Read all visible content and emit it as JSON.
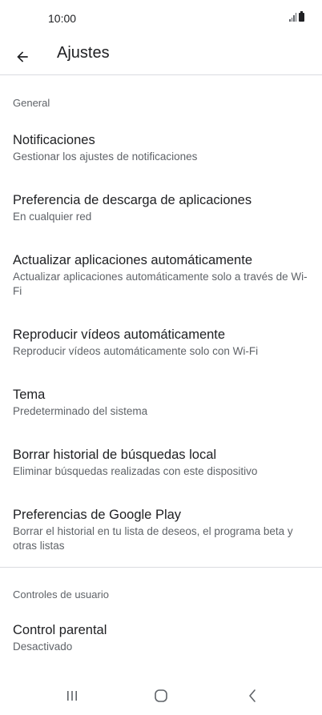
{
  "status_bar": {
    "time": "10:00"
  },
  "header": {
    "title": "Ajustes",
    "back_icon": "arrow-back-icon"
  },
  "sections": [
    {
      "label": "General",
      "items": [
        {
          "title": "Notificaciones",
          "subtitle": "Gestionar los ajustes de notificaciones"
        },
        {
          "title": "Preferencia de descarga de aplicaciones",
          "subtitle": "En cualquier red"
        },
        {
          "title": "Actualizar aplicaciones automáticamente",
          "subtitle": "Actualizar aplicaciones automáticamente solo a través de Wi-Fi"
        },
        {
          "title": "Reproducir vídeos automáticamente",
          "subtitle": "Reproducir vídeos automáticamente solo con Wi-Fi"
        },
        {
          "title": "Tema",
          "subtitle": "Predeterminado del sistema"
        },
        {
          "title": "Borrar historial de búsquedas local",
          "subtitle": "Eliminar búsquedas realizadas con este dispositivo"
        },
        {
          "title": "Preferencias de Google Play",
          "subtitle": "Borrar el historial en tu lista de deseos, el programa beta y otras listas"
        }
      ]
    },
    {
      "label": "Controles de usuario",
      "items": [
        {
          "title": "Control parental",
          "subtitle": "Desactivado"
        }
      ]
    }
  ],
  "nav_bar": {
    "recents_icon": "recents-icon",
    "home_icon": "home-icon",
    "back_icon": "back-chevron-icon"
  }
}
